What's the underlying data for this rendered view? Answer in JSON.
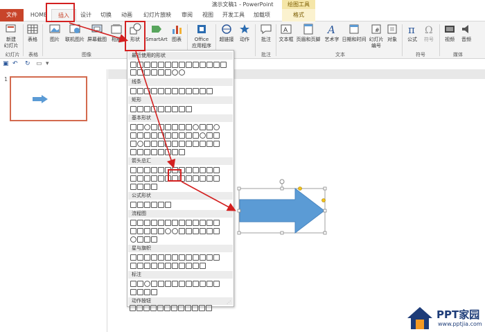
{
  "window": {
    "title": "演示文稿1 - PowerPoint",
    "context_tab_title": "绘图工具"
  },
  "tabs": [
    "文件",
    "HOME",
    "插入",
    "设计",
    "切换",
    "动画",
    "幻灯片放映",
    "审阅",
    "视图",
    "开发工具",
    "加载项",
    "格式"
  ],
  "ribbon": {
    "buttons": {
      "new_slide": "新建\n幻灯片",
      "table": "表格",
      "picture": "图片",
      "online_picture": "联机图片",
      "screenshot": "屏幕截图",
      "album": "相册",
      "shapes": "形状",
      "smartart": "SmartArt",
      "chart": "图表",
      "office_apps": "Office\n应用程序",
      "hyperlink": "超链接",
      "action": "动作",
      "comment": "批注",
      "textbox": "文本框",
      "header_footer": "页眉和页脚",
      "wordart": "艺术字",
      "datetime": "日期和时间",
      "slide_number": "幻灯片\n编号",
      "object": "对象",
      "equation": "公式",
      "symbol": "符号",
      "video": "视频",
      "audio": "音频"
    },
    "groups": {
      "slides": "幻灯片",
      "tables": "表格",
      "images": "图像",
      "comments": "批注",
      "text": "文本",
      "symbols": "符号",
      "media": "媒体"
    }
  },
  "slides_pane": {
    "number": "1"
  },
  "shapes_menu": {
    "sections": [
      "最近使用的形状",
      "线条",
      "矩形",
      "基本形状",
      "箭头总汇",
      "公式形状",
      "流程图",
      "星与旗帜",
      "标注",
      "动作按钮"
    ]
  },
  "colors": {
    "accent": "#c8442a",
    "shape_fill": "#5b9bd5",
    "highlight": "#d32020"
  },
  "watermark": {
    "brand": "PPT家园",
    "url": "www.pptjia.com"
  }
}
